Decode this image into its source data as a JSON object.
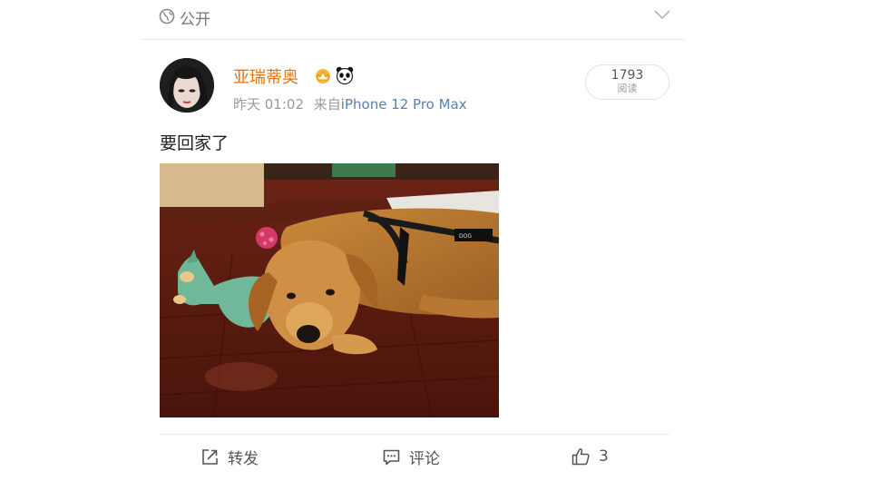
{
  "header": {
    "visibility_label": "公开",
    "globe_icon": "globe-icon",
    "chevron_icon": "chevron-down-icon"
  },
  "post": {
    "author": "亚瑞蒂奥",
    "badges": [
      "crown-badge-icon",
      "panda-badge-icon"
    ],
    "time": "昨天 01:02",
    "source_prefix": "来自",
    "device": "iPhone 12 Pro Max",
    "read_count": "1793",
    "read_label": "阅读",
    "text": "要回家了",
    "image_icon": "golden-retriever-photo"
  },
  "actions": {
    "repost_label": "转发",
    "comment_label": "评论",
    "like_count": "3"
  },
  "colors": {
    "username": "#e8730c",
    "device_link": "#5b7fb0",
    "meta": "#9a9a9a"
  }
}
